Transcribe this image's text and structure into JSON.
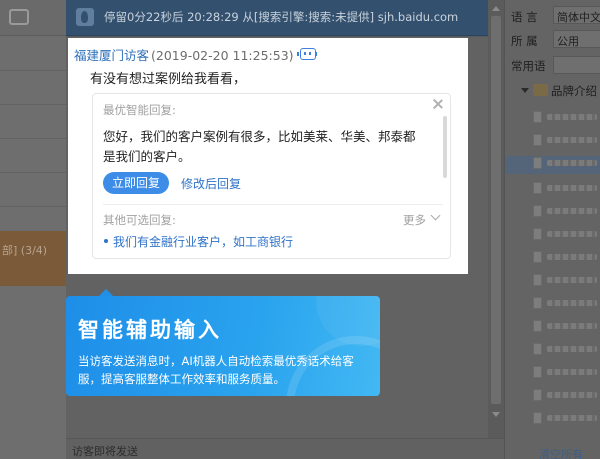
{
  "header": {
    "visit_info": "停留0分22秒后 20:28:29  从[搜索引擎:搜索:未提供] sjh.baidu.com"
  },
  "left_panel": {
    "highlighted_item": "部] (3/4)"
  },
  "message": {
    "visitor_name": "福建厦门访客",
    "timestamp": "(2019-02-20 11:25:53)",
    "text": "有没有想过案例给我看看，"
  },
  "suggestion": {
    "title": "最优智能回复:",
    "text": "您好，我们的客户案例有很多，比如美莱、华美、邦泰都是我们的客户。",
    "reply_button": "立即回复",
    "edit_link": "修改后回复",
    "other_title": "其他可选回复:",
    "more_label": "更多",
    "alternatives": [
      "我们有金融行业客户，如工商银行"
    ]
  },
  "tooltip": {
    "title": "智能辅助输入",
    "description": "当访客发送消息时，AI机器人自动检索最优秀话术给客服，提高客服整体工作效率和服务质量。"
  },
  "footer": {
    "label": "访客即将发送"
  },
  "right_panel": {
    "language_label": "语 言",
    "language_value": "简体中文",
    "belong_label": "所 属",
    "belong_value": "公用",
    "common_label": "常用语",
    "folder_label": "品牌介绍",
    "bottom_link": "清空所有"
  },
  "colors": {
    "accent_blue": "#3d8de8",
    "link_blue": "#2f73c9",
    "tooltip_blue": "#1e8ee8"
  }
}
